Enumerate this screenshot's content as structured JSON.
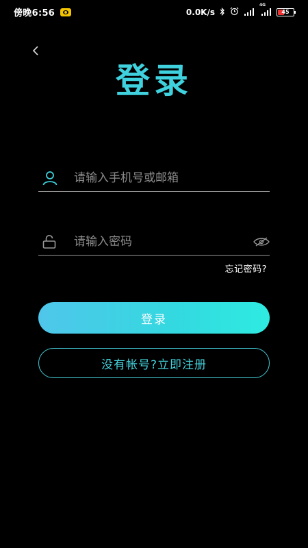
{
  "status_bar": {
    "time": "傍晚6:56",
    "net_speed": "0.0K/s",
    "signal_label": "4G",
    "battery": "45"
  },
  "icons": {
    "back": "chevron-left-icon",
    "user": "user-icon",
    "lock": "lock-icon",
    "eye": "eye-slash-icon"
  },
  "colors": {
    "accent": "#3fd1dd",
    "background": "#000000",
    "gradient_start": "#4fc6ea",
    "gradient_end": "#2eebe1"
  },
  "login": {
    "title": "登录",
    "account_placeholder": "请输入手机号或邮箱",
    "password_placeholder": "请输入密码",
    "forgot_label": "忘记密码?",
    "login_label": "登录",
    "register_label": "没有帐号?立即注册"
  }
}
